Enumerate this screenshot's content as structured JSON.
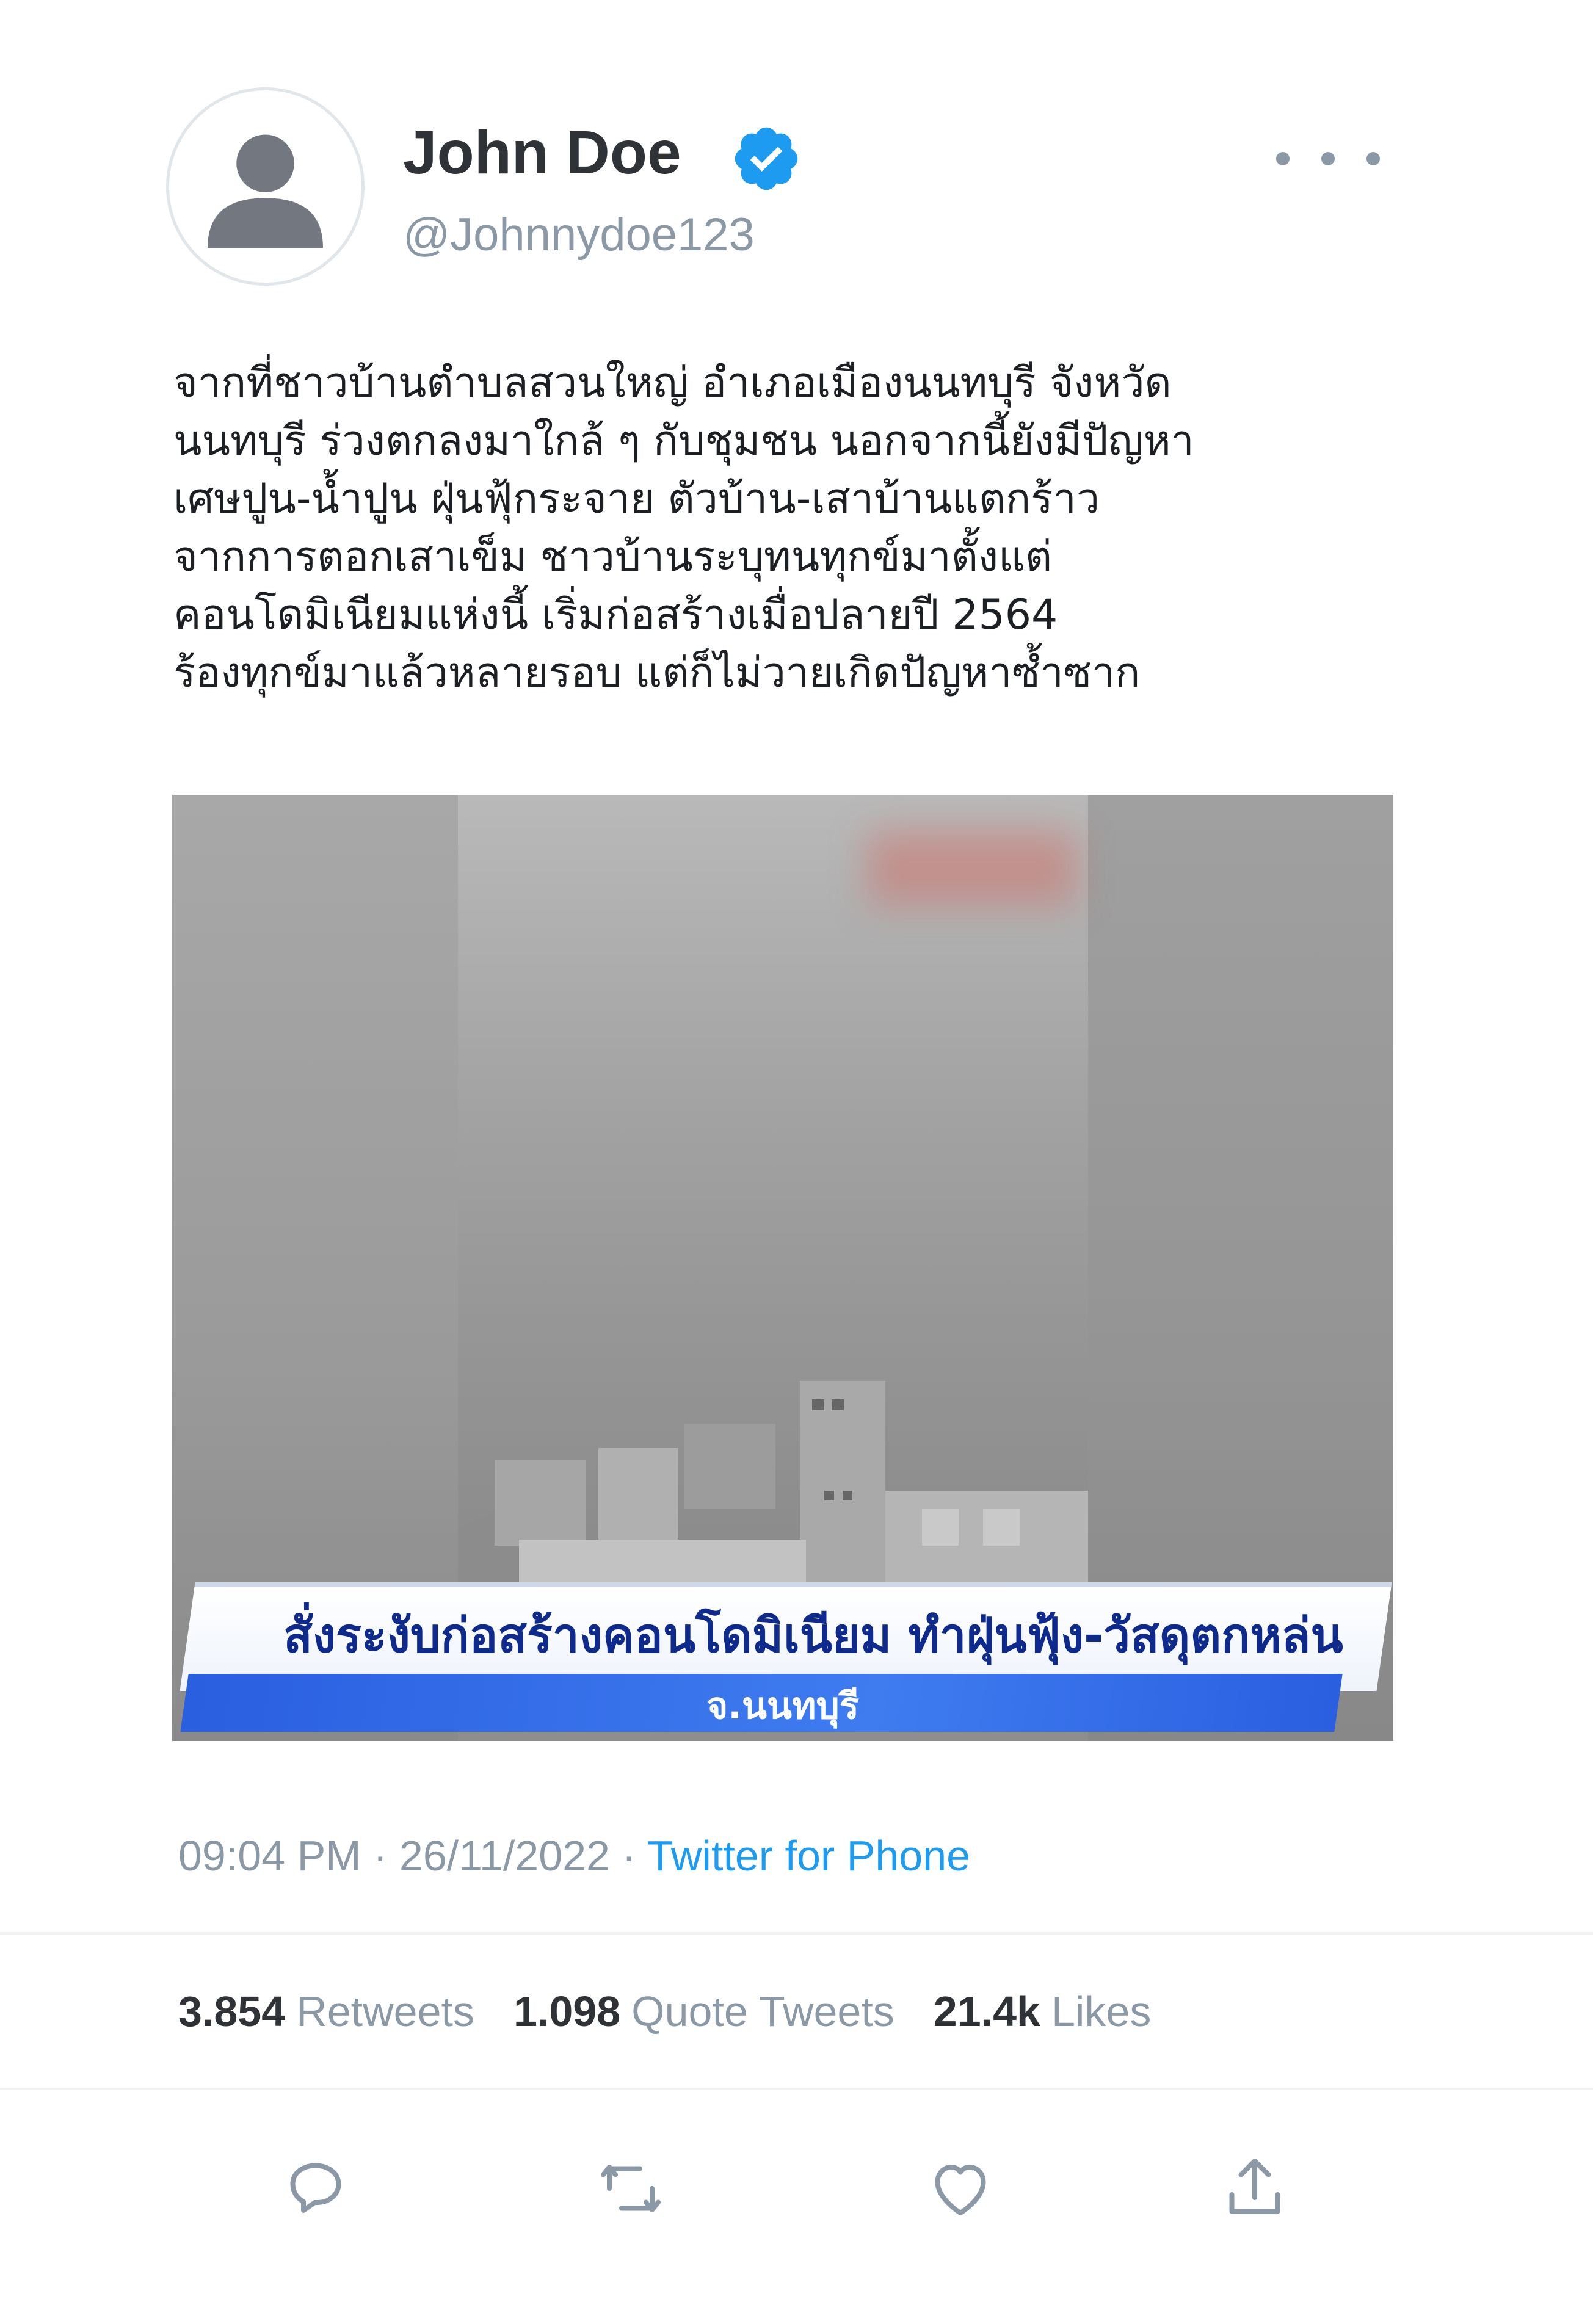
{
  "author": {
    "name": "John Doe",
    "handle": "@Johnnydoe123",
    "verified_icon": "verified-badge-icon",
    "avatar_icon": "default-avatar-icon"
  },
  "menu_icon": "more-options-icon",
  "tweet": {
    "lines": [
      "จากที่ชาวบ้านตำบลสวนใหญ่ อำเภอเมืองนนทบุรี จังหวัด",
      "นนทบุรี ร่วงตกลงมาใกล้ ๆ กับชุมชน นอกจากนี้ยังมีปัญหา",
      "เศษปูน-น้ำปูน ฝุ่นฟุ้กระจาย ตัวบ้าน-เสาบ้านแตกร้าว",
      "จากการตอกเสาเข็ม ชาวบ้านระบุทนทุกข์มาตั้งแต่",
      "คอนโดมิเนียมแห่งนี้ เริ่มก่อสร้างเมื่อปลายปี 2564",
      "ร้องทุกข์มาแล้วหลายรอบ แต่ก็ไม่วายเกิดปัญหาซ้ำซาก"
    ]
  },
  "media": {
    "headline": "สั่งระงับก่อสร้างคอนโดมิเนียม ทำฝุ่นฟุ้ง-วัสดุตกหล่น",
    "subline": "จ.นนทบุรี"
  },
  "meta": {
    "time": "09:04 PM",
    "date": "26/11/2022",
    "source": "Twitter for Phone",
    "sep": " · "
  },
  "stats": {
    "retweets": "3.854",
    "retweets_label": "Retweets",
    "quotes": "1.098",
    "quotes_label": "Quote Tweets",
    "likes": "21.4k",
    "likes_label": "Likes"
  },
  "actions": [
    "reply-icon",
    "retweet-icon",
    "like-icon",
    "share-icon"
  ],
  "colors": {
    "link": "#1d9bf0",
    "muted": "#8b98a5",
    "verified": "#1d9bf0",
    "text": "#0f1419"
  }
}
